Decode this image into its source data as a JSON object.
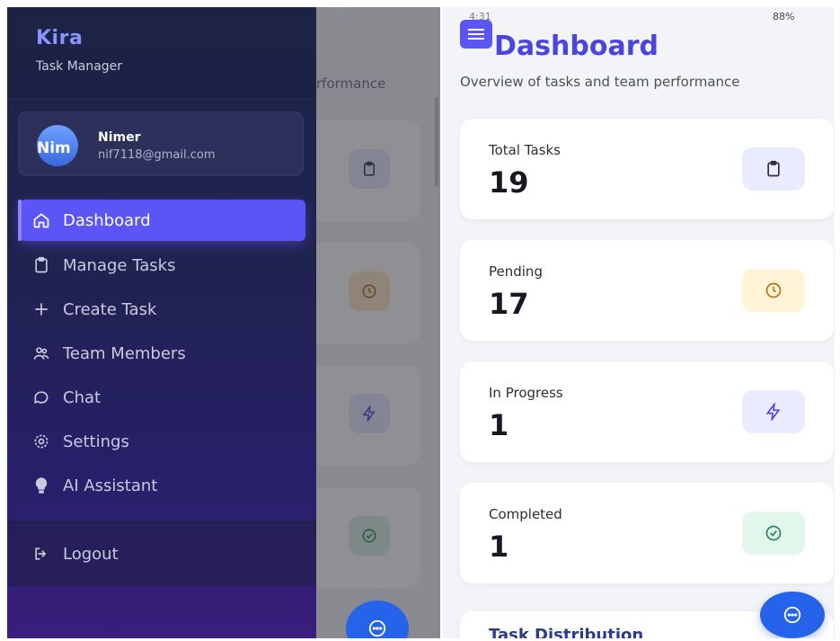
{
  "status_bar": {
    "time": "4:31",
    "battery": "88%"
  },
  "drawer": {
    "brand": "Kira",
    "subtitle": "Task Manager",
    "user": {
      "initials": "Nim",
      "name": "Nimer",
      "email": "nif7118@gmail.com"
    },
    "items": [
      {
        "label": "Dashboard",
        "icon": "home-icon",
        "active": true
      },
      {
        "label": "Manage Tasks",
        "icon": "clipboard-icon"
      },
      {
        "label": "Create Task",
        "icon": "plus-icon"
      },
      {
        "label": "Team Members",
        "icon": "users-icon"
      },
      {
        "label": "Chat",
        "icon": "chat-icon"
      },
      {
        "label": "Settings",
        "icon": "gear-icon"
      },
      {
        "label": "AI Assistant",
        "icon": "bulb-icon"
      }
    ],
    "logout": "Logout",
    "background_peek": "rformance"
  },
  "dashboard": {
    "title": "Dashboard",
    "subtitle": "Overview of tasks and team performance",
    "cards": [
      {
        "label": "Total Tasks",
        "value": "19",
        "icon": "clipboard-icon",
        "color": "#e9ebff"
      },
      {
        "label": "Pending",
        "value": "17",
        "icon": "clock-icon",
        "color": "#fff4d6"
      },
      {
        "label": "In Progress",
        "value": "1",
        "icon": "bolt-icon",
        "color": "#e9ebff"
      },
      {
        "label": "Completed",
        "value": "1",
        "icon": "check-circle-icon",
        "color": "#e0f7ea"
      }
    ],
    "section_title": "Task Distribution"
  },
  "colors": {
    "accent": "#5b55f5",
    "fab": "#2563eb"
  }
}
